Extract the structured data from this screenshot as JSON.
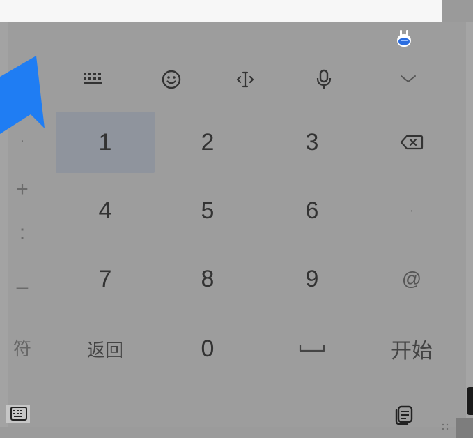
{
  "toolbar": {
    "icons": [
      "keyboard-grid-icon",
      "emoji-icon",
      "cursor-move-icon",
      "microphone-icon",
      "collapse-chevron-icon"
    ],
    "assistant_icon": "robot-assistant-icon"
  },
  "keypad": {
    "rows": [
      [
        "1",
        "2",
        "3"
      ],
      [
        "4",
        "5",
        "6"
      ],
      [
        "7",
        "8",
        "9"
      ],
      [
        "返回",
        "0",
        ""
      ]
    ],
    "right_column": [
      "⌫",
      "·",
      "@",
      "开始"
    ]
  },
  "side_symbols": [
    "·",
    "+",
    ":",
    "–",
    "符"
  ],
  "colors": {
    "overlay": "#9d9d9d",
    "active_key": "#8f949d",
    "arrow": "#1f7df3"
  }
}
